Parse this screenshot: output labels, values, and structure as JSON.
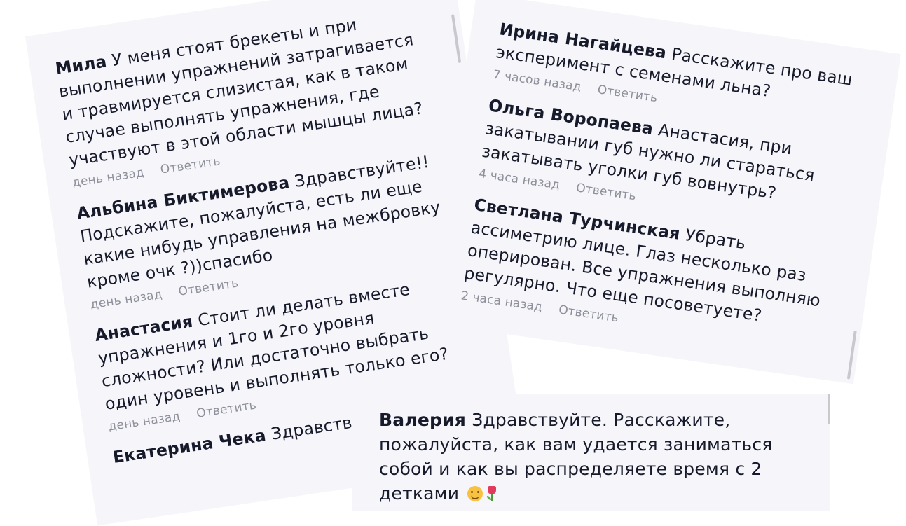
{
  "left_card": {
    "comments": [
      {
        "author": "Мила",
        "text": "У меня стоят брекеты и при выполнении упражнений затрагивается и травмируется слизистая, как в таком случае выполнять упражнения, где участвуют в этой области мышцы лица?",
        "time": "день назад",
        "reply": "Ответить"
      },
      {
        "author": "Альбина Биктимерова",
        "text": "Здравствуйте!! Подскажите, пожалуйста, есть ли еще какие нибудь управления на межбровку кроме очк ?))спасибо",
        "time": "день назад",
        "reply": "Ответить"
      },
      {
        "author": "Анастасия",
        "text": "Стоит ли делать вместе упражнения и 1го и 2го уровня сложности? Или достаточно выбрать один уровень и выполнять только его?",
        "time": "день назад",
        "reply": "Ответить"
      },
      {
        "author": "Екатерина Чека",
        "text": "Здравствуйте."
      }
    ]
  },
  "right_card": {
    "comments": [
      {
        "author": "Ирина Нагайцева",
        "text": "Расскажите про ваш эксперимент с семенами льна?",
        "time": "7 часов назад",
        "reply": "Ответить"
      },
      {
        "author": "Ольга Воропаева",
        "text": "Анастасия, при закатывании губ нужно ли стараться закатывать уголки губ вовнутрь?",
        "time": "4 часа назад",
        "reply": "Ответить"
      },
      {
        "author": "Светлана Турчинская",
        "text": "Убрать ассиметрию лице. Глаз несколько раз оперирован. Все упражнения выполняю регулярно. Что еще посоветуете?",
        "time": "2 часа назад",
        "reply": "Ответить"
      }
    ]
  },
  "bottom_card": {
    "author": "Валерия",
    "text": "Здравствуйте. Расскажите, пожалуйста, как вам удается заниматься собой и как вы распределяете время с 2 детками",
    "emoji_icons": [
      "hugging-face-icon",
      "tulip-icon"
    ]
  },
  "colors": {
    "card_bg": "#f6f5fa",
    "text": "#161a2b",
    "meta": "#8d8f9a"
  }
}
